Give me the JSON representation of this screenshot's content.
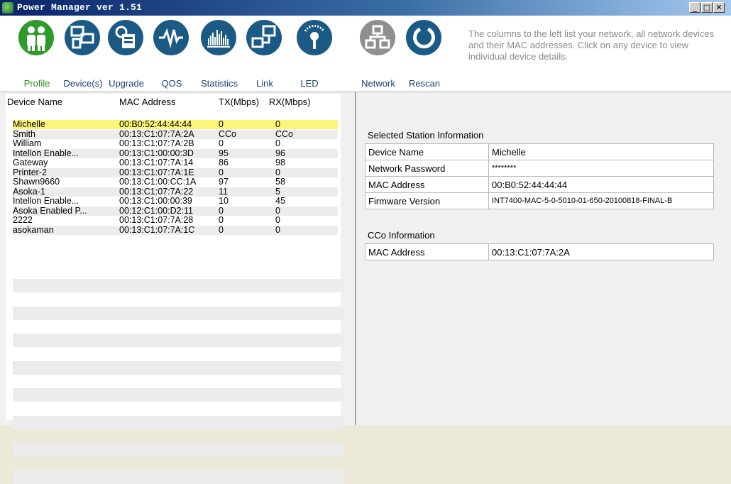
{
  "window": {
    "title": "Power Manager ver 1.51"
  },
  "toolbar": {
    "buttons": [
      {
        "label": "Profile",
        "icon": "profile-icon"
      },
      {
        "label": "Device(s)",
        "icon": "devices-icon"
      },
      {
        "label": "Upgrade",
        "icon": "upgrade-icon"
      },
      {
        "label": "QOS",
        "icon": "qos-icon"
      },
      {
        "label": "Statistics",
        "icon": "statistics-icon"
      },
      {
        "label": "Link",
        "icon": "link-icon"
      },
      {
        "label": "LED",
        "icon": "led-icon"
      },
      {
        "label": "Network",
        "icon": "network-icon"
      },
      {
        "label": "Rescan",
        "icon": "rescan-icon"
      }
    ],
    "help_text": "The columns to the left list your network, all network devices and their MAC addresses. Click on any device to view individual device details."
  },
  "device_list": {
    "headers": [
      "Device Name",
      "MAC Address",
      "TX(Mbps)",
      "RX(Mbps)"
    ],
    "rows": [
      [
        "Michelle",
        "00:B0:52:44:44:44",
        "0",
        "0"
      ],
      [
        "Smith",
        "00:13:C1:07:7A:2A",
        "CCo",
        "CCo"
      ],
      [
        "William",
        "00:13:C1:07:7A:2B",
        "0",
        "0"
      ],
      [
        "Intellon Enable...",
        "00:13:C1:00:00:3D",
        "95",
        "96"
      ],
      [
        "Gateway",
        "00:13:C1:07:7A:14",
        "86",
        "98"
      ],
      [
        "Printer-2",
        "00:13:C1:07:7A:1E",
        "0",
        "0"
      ],
      [
        "Shawn9660",
        "00:13:C1:00:CC:1A",
        "97",
        "58"
      ],
      [
        "Asoka-1",
        "00:13:C1:07:7A:22",
        "11",
        "5"
      ],
      [
        "Intellon Enable...",
        "00:13:C1:00:00:39",
        "10",
        "45"
      ],
      [
        "Asoka Enabled P...",
        "00:12:C1:00:D2:11",
        "0",
        "0"
      ],
      [
        "2222",
        "00:13:C1:07:7A:28",
        "0",
        "0"
      ],
      [
        "asokaman",
        "00:13:C1:07:7A:1C",
        "0",
        "0"
      ]
    ],
    "selected_index": 0
  },
  "station_info": {
    "title": "Selected Station Information",
    "rows": [
      {
        "label": "Device Name",
        "value": "Michelle"
      },
      {
        "label": "Network Password",
        "value": "********"
      },
      {
        "label": "MAC Address",
        "value": "00:B0:52:44:44:44"
      },
      {
        "label": "Firmware Version",
        "value": "INT7400-MAC-5-0-5010-01-650-20100818-FINAL-B"
      }
    ]
  },
  "cco_info": {
    "title": "CCo Information",
    "rows": [
      {
        "label": "MAC Address",
        "value": "00:13:C1:07:7A:2A"
      }
    ]
  },
  "colors": {
    "selected_row": "#fbf67a",
    "toolbar_icon": "#1b5a84",
    "active_icon": "#2f9a2a"
  }
}
